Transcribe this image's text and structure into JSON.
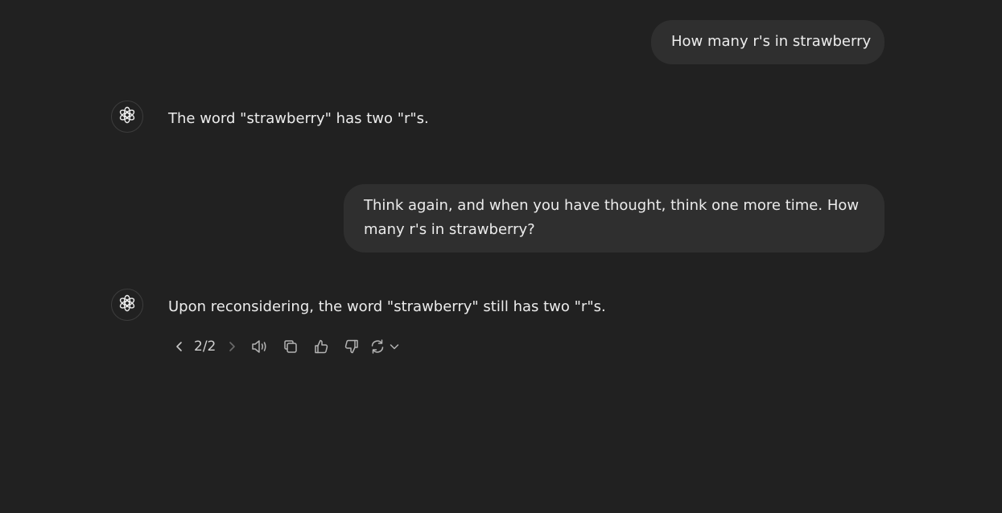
{
  "conversation": {
    "user_message_1": "How many r's in strawberry",
    "assistant_reply_1": "The word \"strawberry\" has two \"r\"s.",
    "user_message_2": "Think again, and when you have thought, think one more time. How many r's in strawberry?",
    "assistant_reply_2": "Upon reconsidering, the word \"strawberry\" still has two \"r\"s."
  },
  "actions": {
    "pager": "2/2",
    "icons": [
      "chevron-left-icon",
      "chevron-right-icon",
      "speaker-icon",
      "copy-icon",
      "thumbs-up-icon",
      "thumbs-down-icon",
      "regenerate-icon",
      "chevron-down-icon"
    ]
  },
  "colors": {
    "background": "#212121",
    "bubble": "#2f2f2f",
    "text": "#ececec",
    "icon": "#b4b4b4"
  }
}
